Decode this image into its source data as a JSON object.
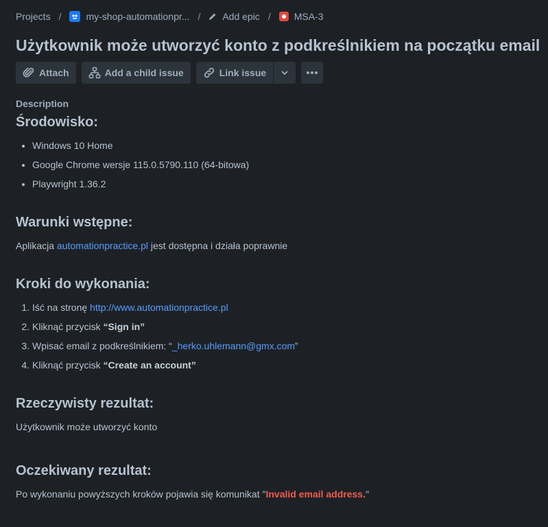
{
  "breadcrumb": {
    "projects": "Projects",
    "project_name": "my-shop-automationpr...",
    "add_epic": "Add epic",
    "issue_key": "MSA-3"
  },
  "title": "Użytkownik może utworzyć konto z podkreślnikiem na początku email",
  "toolbar": {
    "attach": "Attach",
    "add_child": "Add a child issue",
    "link_issue": "Link issue"
  },
  "description_label": "Description",
  "sections": {
    "env": {
      "heading": "Środowisko:",
      "items": [
        "Windows 10 Home",
        "Google Chrome wersje 115.0.5790.110 (64-bitowa)",
        "Playwright 1.36.2"
      ]
    },
    "preconditions": {
      "heading": "Warunki wstępne:",
      "prefix": "Aplikacja ",
      "link": "automationpractice.pl",
      "suffix": " jest dostępna i działa poprawnie"
    },
    "steps": {
      "heading": "Kroki do wykonania:",
      "s1_prefix": "Iść na stronę ",
      "s1_link": "http://www.automationpractice.pl",
      "s2_prefix": "Kliknąć przycisk ",
      "s2_bold": "“Sign in”",
      "s3_prefix": "Wpisać email z podkreślnikiem: “",
      "s3_link": "_herko.uhlemann@gmx.com",
      "s3_suffix": "”",
      "s4_prefix": "Kliknąć przycisk ",
      "s4_bold": "“Create an account”"
    },
    "actual": {
      "heading": "Rzeczywisty rezultat:",
      "text": "Użytkownik może utworzyć konto"
    },
    "expected": {
      "heading": "Oczekiwany rezultat:",
      "prefix": "Po wykonaniu powyższych kroków pojawia się komunikat \"",
      "error": "Invalid email address.",
      "suffix": "\""
    }
  },
  "colors": {
    "background": "#1d2125",
    "text": "#b6c2cf",
    "link": "#579dff",
    "error": "#f15b50",
    "button": "#2c333a"
  }
}
